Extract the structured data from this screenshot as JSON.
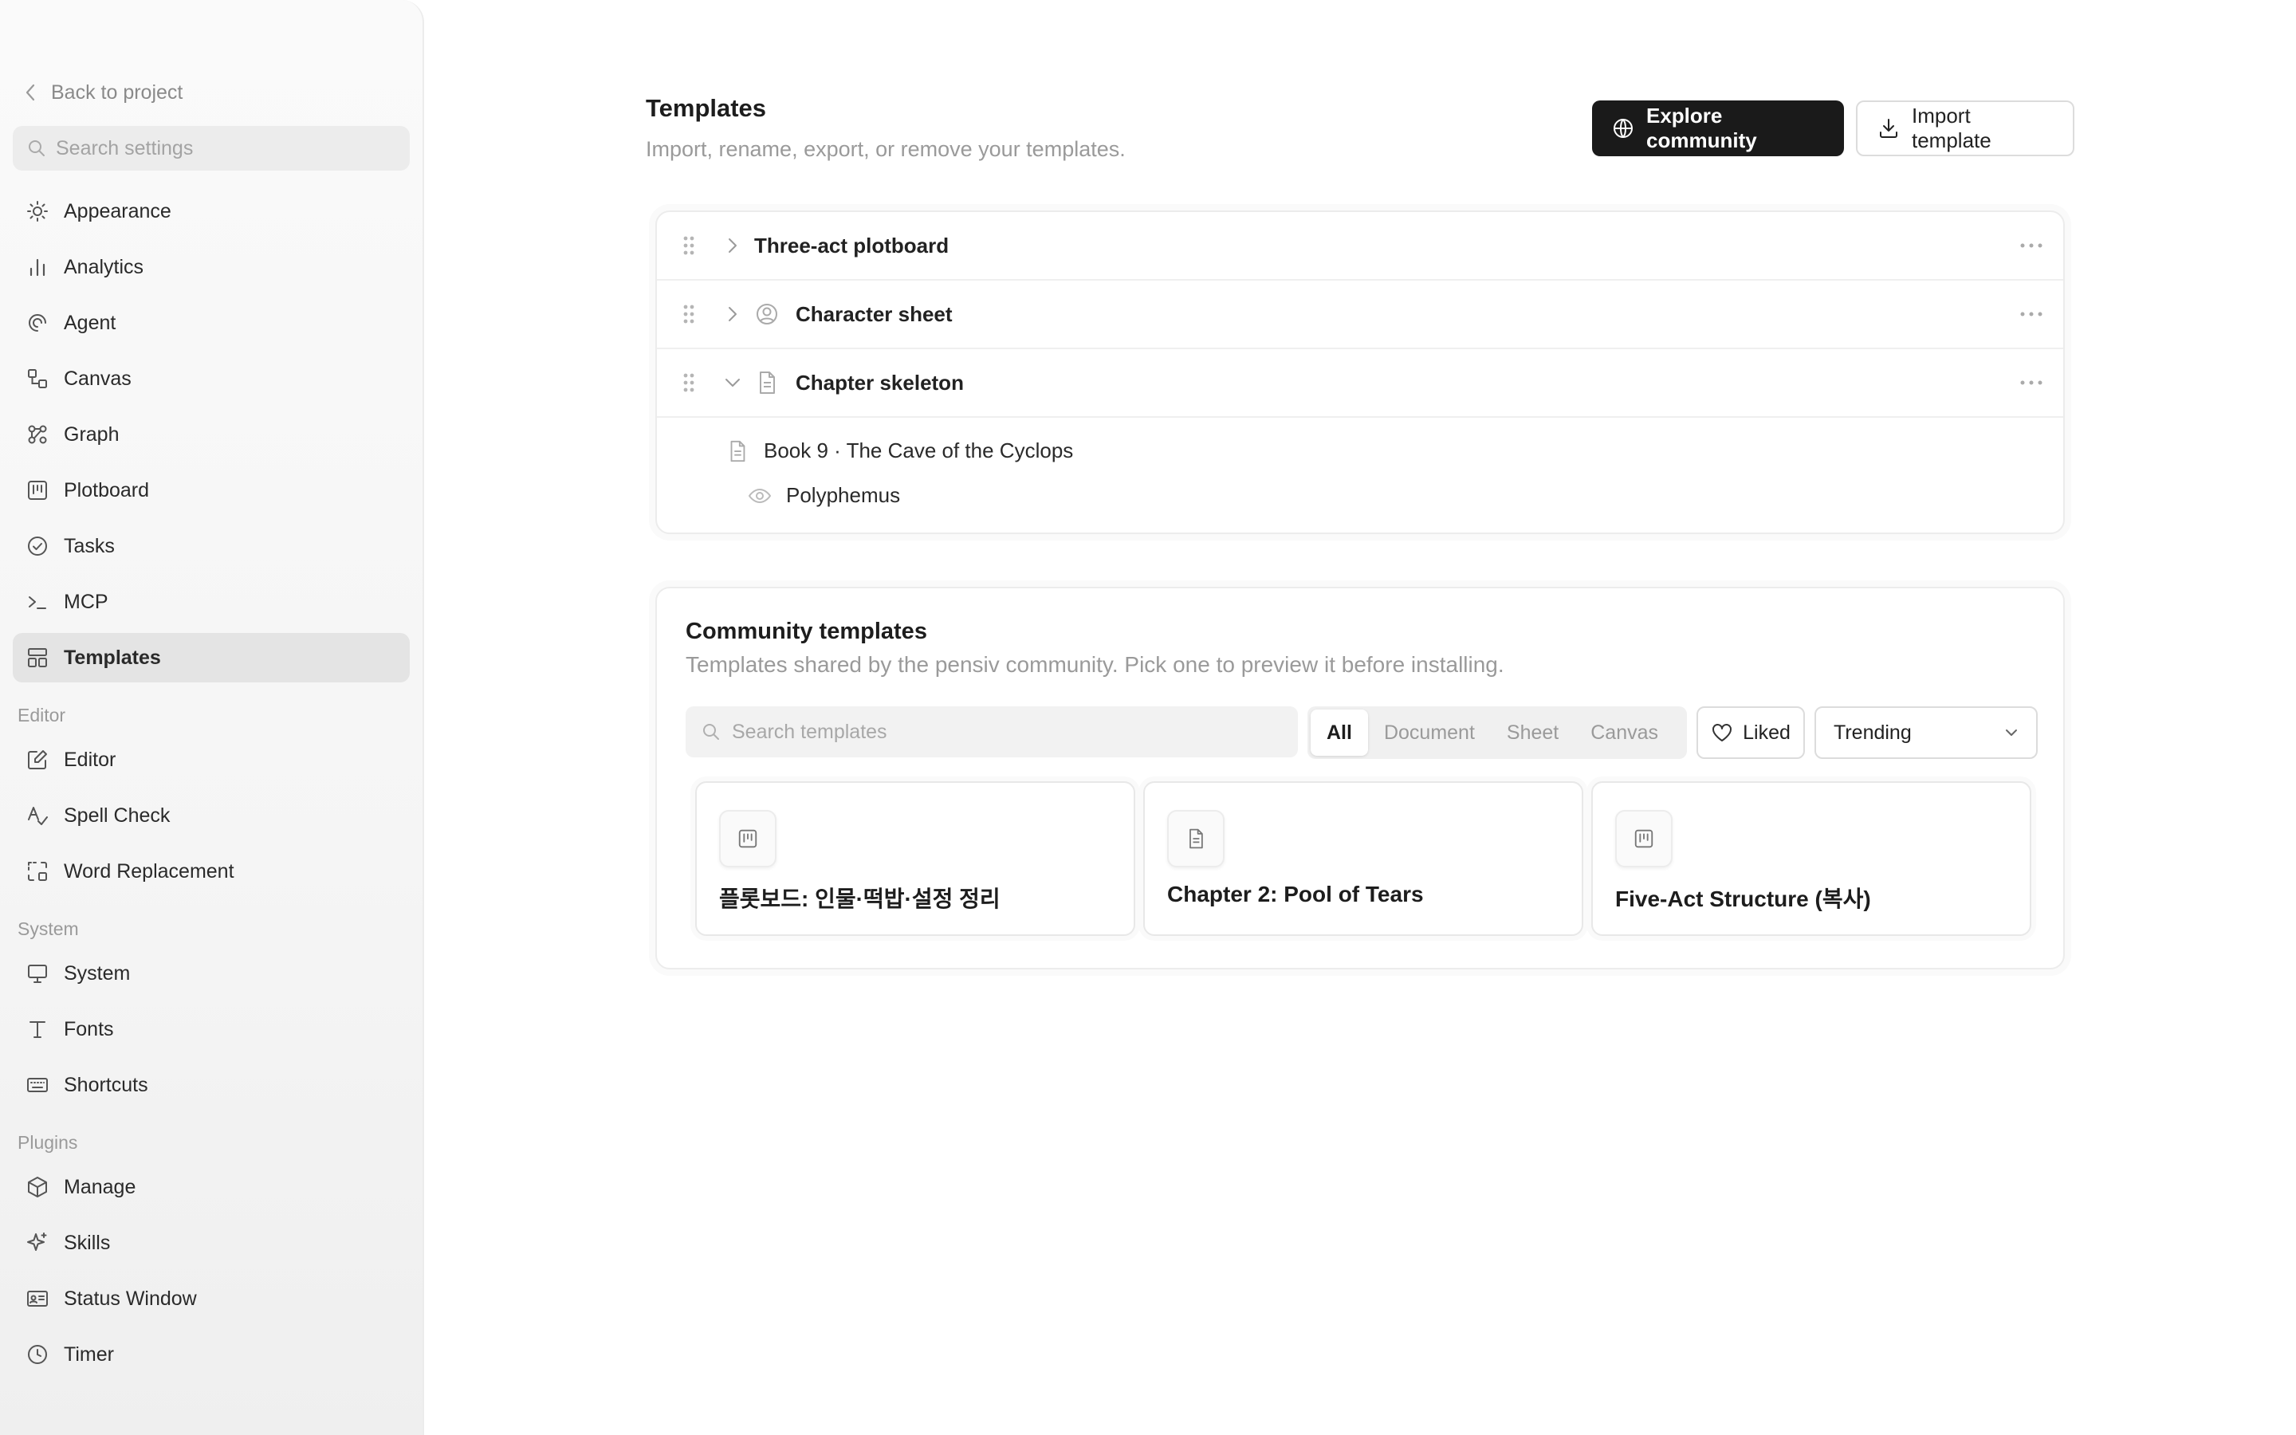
{
  "sidebar": {
    "back_label": "Back to project",
    "search_placeholder": "Search settings",
    "items_general": [
      {
        "label": "Appearance",
        "icon": "sun-icon"
      },
      {
        "label": "Analytics",
        "icon": "bar-chart-icon"
      },
      {
        "label": "Agent",
        "icon": "swirl-icon"
      },
      {
        "label": "Canvas",
        "icon": "shapes-icon"
      },
      {
        "label": "Graph",
        "icon": "graph-icon"
      },
      {
        "label": "Plotboard",
        "icon": "kanban-icon"
      },
      {
        "label": "Tasks",
        "icon": "check-circle-icon"
      },
      {
        "label": "MCP",
        "icon": "terminal-icon"
      },
      {
        "label": "Templates",
        "icon": "layout-icon",
        "active": true
      }
    ],
    "section_editor": "Editor",
    "items_editor": [
      {
        "label": "Editor",
        "icon": "pencil-square-icon"
      },
      {
        "label": "Spell Check",
        "icon": "spell-check-icon"
      },
      {
        "label": "Word Replacement",
        "icon": "replace-icon"
      }
    ],
    "section_system": "System",
    "items_system": [
      {
        "label": "System",
        "icon": "monitor-icon"
      },
      {
        "label": "Fonts",
        "icon": "type-icon"
      },
      {
        "label": "Shortcuts",
        "icon": "keyboard-icon"
      }
    ],
    "section_plugins": "Plugins",
    "items_plugins": [
      {
        "label": "Manage",
        "icon": "package-icon"
      },
      {
        "label": "Skills",
        "icon": "sparkle-icon"
      },
      {
        "label": "Status Window",
        "icon": "id-card-icon"
      },
      {
        "label": "Timer",
        "icon": "clock-icon"
      }
    ]
  },
  "header": {
    "title": "Templates",
    "subtitle": "Import, rename, export, or remove your templates.",
    "explore_label": "Explore community",
    "import_label": "Import template"
  },
  "templates": [
    {
      "name": "Three-act plotboard",
      "expanded": false
    },
    {
      "name": "Character sheet",
      "expanded": false
    },
    {
      "name": "Chapter skeleton",
      "expanded": true
    }
  ],
  "chapter_children": {
    "chapter": "Book 9 · The Cave of the Cyclops",
    "character": "Polyphemus"
  },
  "community": {
    "title": "Community templates",
    "subtitle": "Templates shared by the pensiv community. Pick one to preview it before installing.",
    "search_placeholder": "Search templates",
    "filters": [
      "All",
      "Document",
      "Sheet",
      "Canvas"
    ],
    "active_filter": "All",
    "liked_label": "Liked",
    "sort_value": "Trending",
    "cards": [
      {
        "title": "플롯보드: 인물·떡밥·설정 정리",
        "icon": "kanban-icon"
      },
      {
        "title": "Chapter 2: Pool of Tears",
        "icon": "document-icon"
      },
      {
        "title": "Five-Act Structure (복사)",
        "icon": "kanban-icon"
      }
    ]
  },
  "colors": {
    "primary_button": "#1a1a1a",
    "active_nav": "#e4e4e4",
    "muted_text": "#9a9a9a"
  }
}
